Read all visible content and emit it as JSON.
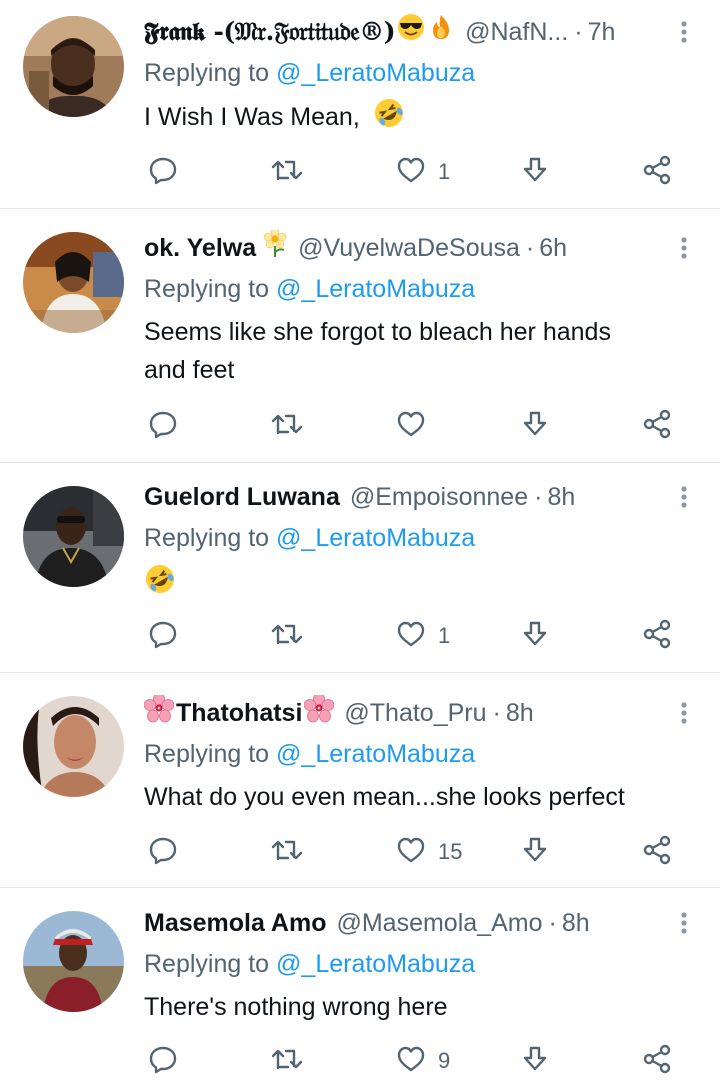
{
  "tweets": [
    {
      "name": "𝕱𝖗𝖆𝖓𝖐 -(𝔐𝔯.𝔉𝔬𝔯𝔱𝔦𝔱𝔲𝔡𝔢®)",
      "name_emojis": [
        "sunglasses-emoji",
        "fire-emoji"
      ],
      "handle": "@NafN...",
      "time": "7h",
      "replying_label": "Replying to",
      "mention": "@_LeratoMabuza",
      "text": "I Wish I Was Mean,",
      "text_emoji": "rofl-emoji",
      "likes": "1"
    },
    {
      "name": "ok. Yelwa",
      "name_emojis": [
        "blossom-emoji"
      ],
      "handle": "@VuyelwaDeSousa",
      "time": "6h",
      "replying_label": "Replying to",
      "mention": "@_LeratoMabuza",
      "text_lines": [
        "Seems like she forgot to bleach her hands",
        "and feet"
      ],
      "likes": ""
    },
    {
      "name": "Guelord Luwana",
      "handle": "@Empoisonnee",
      "time": "8h",
      "replying_label": "Replying to",
      "mention": "@_LeratoMabuza",
      "text": "",
      "text_emoji": "rofl-emoji",
      "likes": "1"
    },
    {
      "name": "Thatohatsi",
      "name_emojis": [
        "hibiscus-emoji",
        "hibiscus-emoji"
      ],
      "handle": "@Thato_Pru",
      "time": "8h",
      "replying_label": "Replying to",
      "mention": "@_LeratoMabuza",
      "text": "What do you even mean...she looks perfect",
      "likes": "15"
    },
    {
      "name": "Masemola Amo",
      "handle": "@Masemola_Amo",
      "time": "8h",
      "replying_label": "Replying to",
      "mention": "@_LeratoMabuza",
      "text": "There's nothing wrong here",
      "likes": "9"
    }
  ],
  "separator": "·",
  "colors": {
    "text": "#0f1419",
    "secondary": "#536471",
    "link": "#1d9bf0",
    "divider": "#e3e7ea"
  },
  "icons": [
    "reply-icon",
    "retweet-icon",
    "like-icon",
    "share-icon",
    "more-icon"
  ]
}
